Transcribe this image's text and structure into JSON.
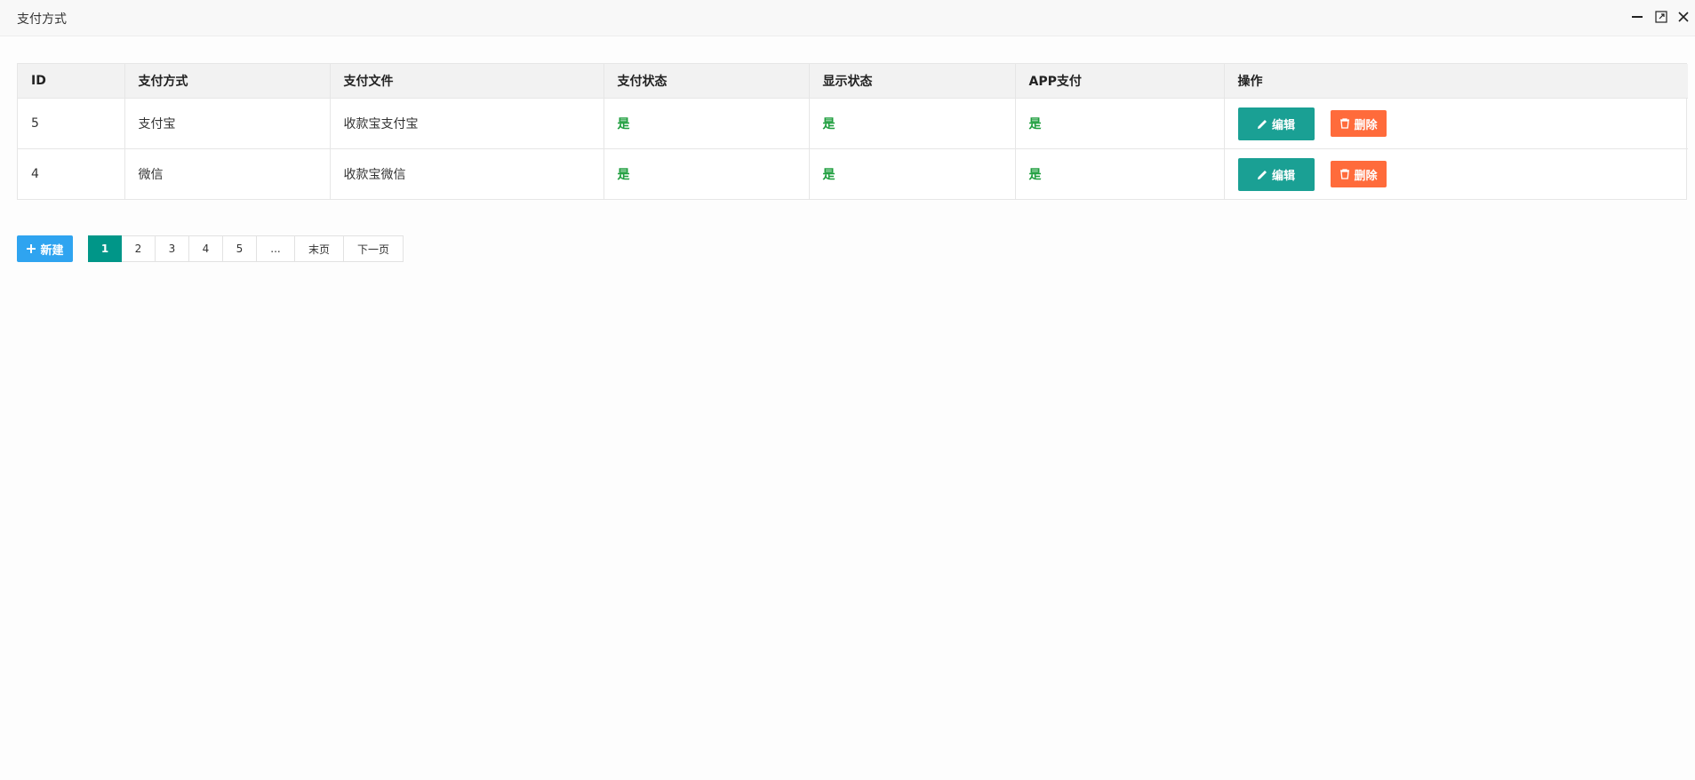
{
  "window": {
    "title": "支付方式",
    "icons": [
      "minimize-icon",
      "maximize-icon",
      "close-icon"
    ]
  },
  "table": {
    "columns": [
      "ID",
      "支付方式",
      "支付文件",
      "支付状态",
      "显示状态",
      "APP支付",
      "操作"
    ],
    "rows": [
      {
        "id": "5",
        "method": "支付宝",
        "file": "收款宝支付宝",
        "pay_status": "是",
        "show_status": "是",
        "app_pay": "是"
      },
      {
        "id": "4",
        "method": "微信",
        "file": "收款宝微信",
        "pay_status": "是",
        "show_status": "是",
        "app_pay": "是"
      }
    ],
    "actions": {
      "edit_label": "编辑",
      "delete_label": "删除"
    }
  },
  "toolbar": {
    "add_label": "新建"
  },
  "pagination": {
    "pages": [
      "1",
      "2",
      "3",
      "4",
      "5"
    ],
    "current": "1",
    "ellipsis": "...",
    "last_label": "末页",
    "next_label": "下一页"
  },
  "colors": {
    "accent_green": "#009688",
    "edit_button": "#1aa094",
    "delete_button": "#ff6b3b",
    "add_button": "#2fa4f0",
    "yes_text": "#1e9e3e"
  }
}
